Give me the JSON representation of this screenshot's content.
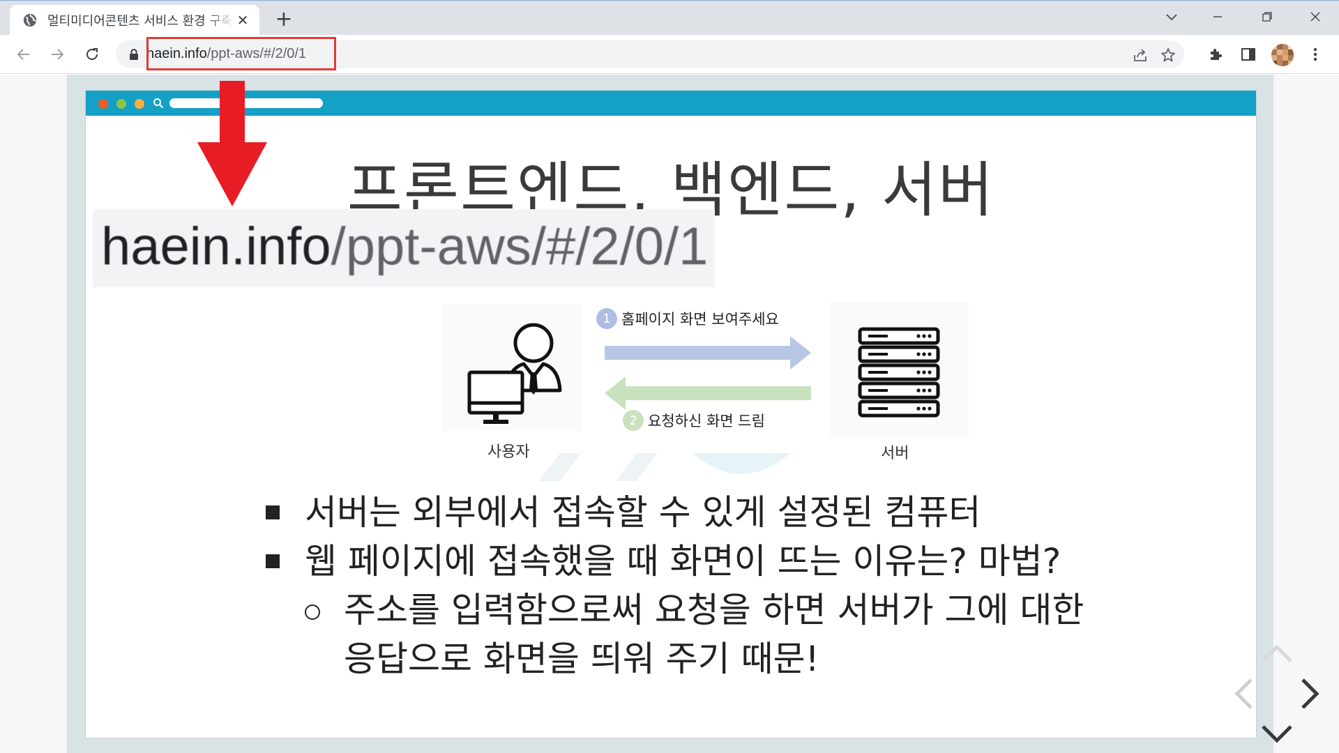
{
  "browser": {
    "tab_title": "멀티미디어콘텐츠 서비스 환경 구축",
    "url_host": "haein.info",
    "url_path": "/ppt-aws/#/2/0/1"
  },
  "slide": {
    "title": "프론트엔드, 백엔드, 서버",
    "zoom_url_host": "haein.info",
    "zoom_url_path": "/ppt-aws/#/2/0/1",
    "diagram": {
      "user_label": "사용자",
      "server_label": "서버",
      "step1_num": "1",
      "step1_text": "홈페이지 화면 보여주세요",
      "step2_num": "2",
      "step2_text": "요청하신 화면 드림"
    },
    "bullets": [
      "서버는 외부에서 접속할 수 있게 설정된 컴퓨터",
      "웹 페이지에 접속했을 때 화면이 뜨는 이유는? 마법?"
    ],
    "sub_bullet_line1": "주소를 입력함으로써 요청을 하면 서버가 그에 대한",
    "sub_bullet_line2": "응답으로 화면을 띄워 주기 때문!"
  },
  "colors": {
    "slide_bar": "#15a0c6",
    "highlight": "#e53935",
    "arrow_request": "#b8c6e6",
    "arrow_response": "#c8e2bd"
  }
}
